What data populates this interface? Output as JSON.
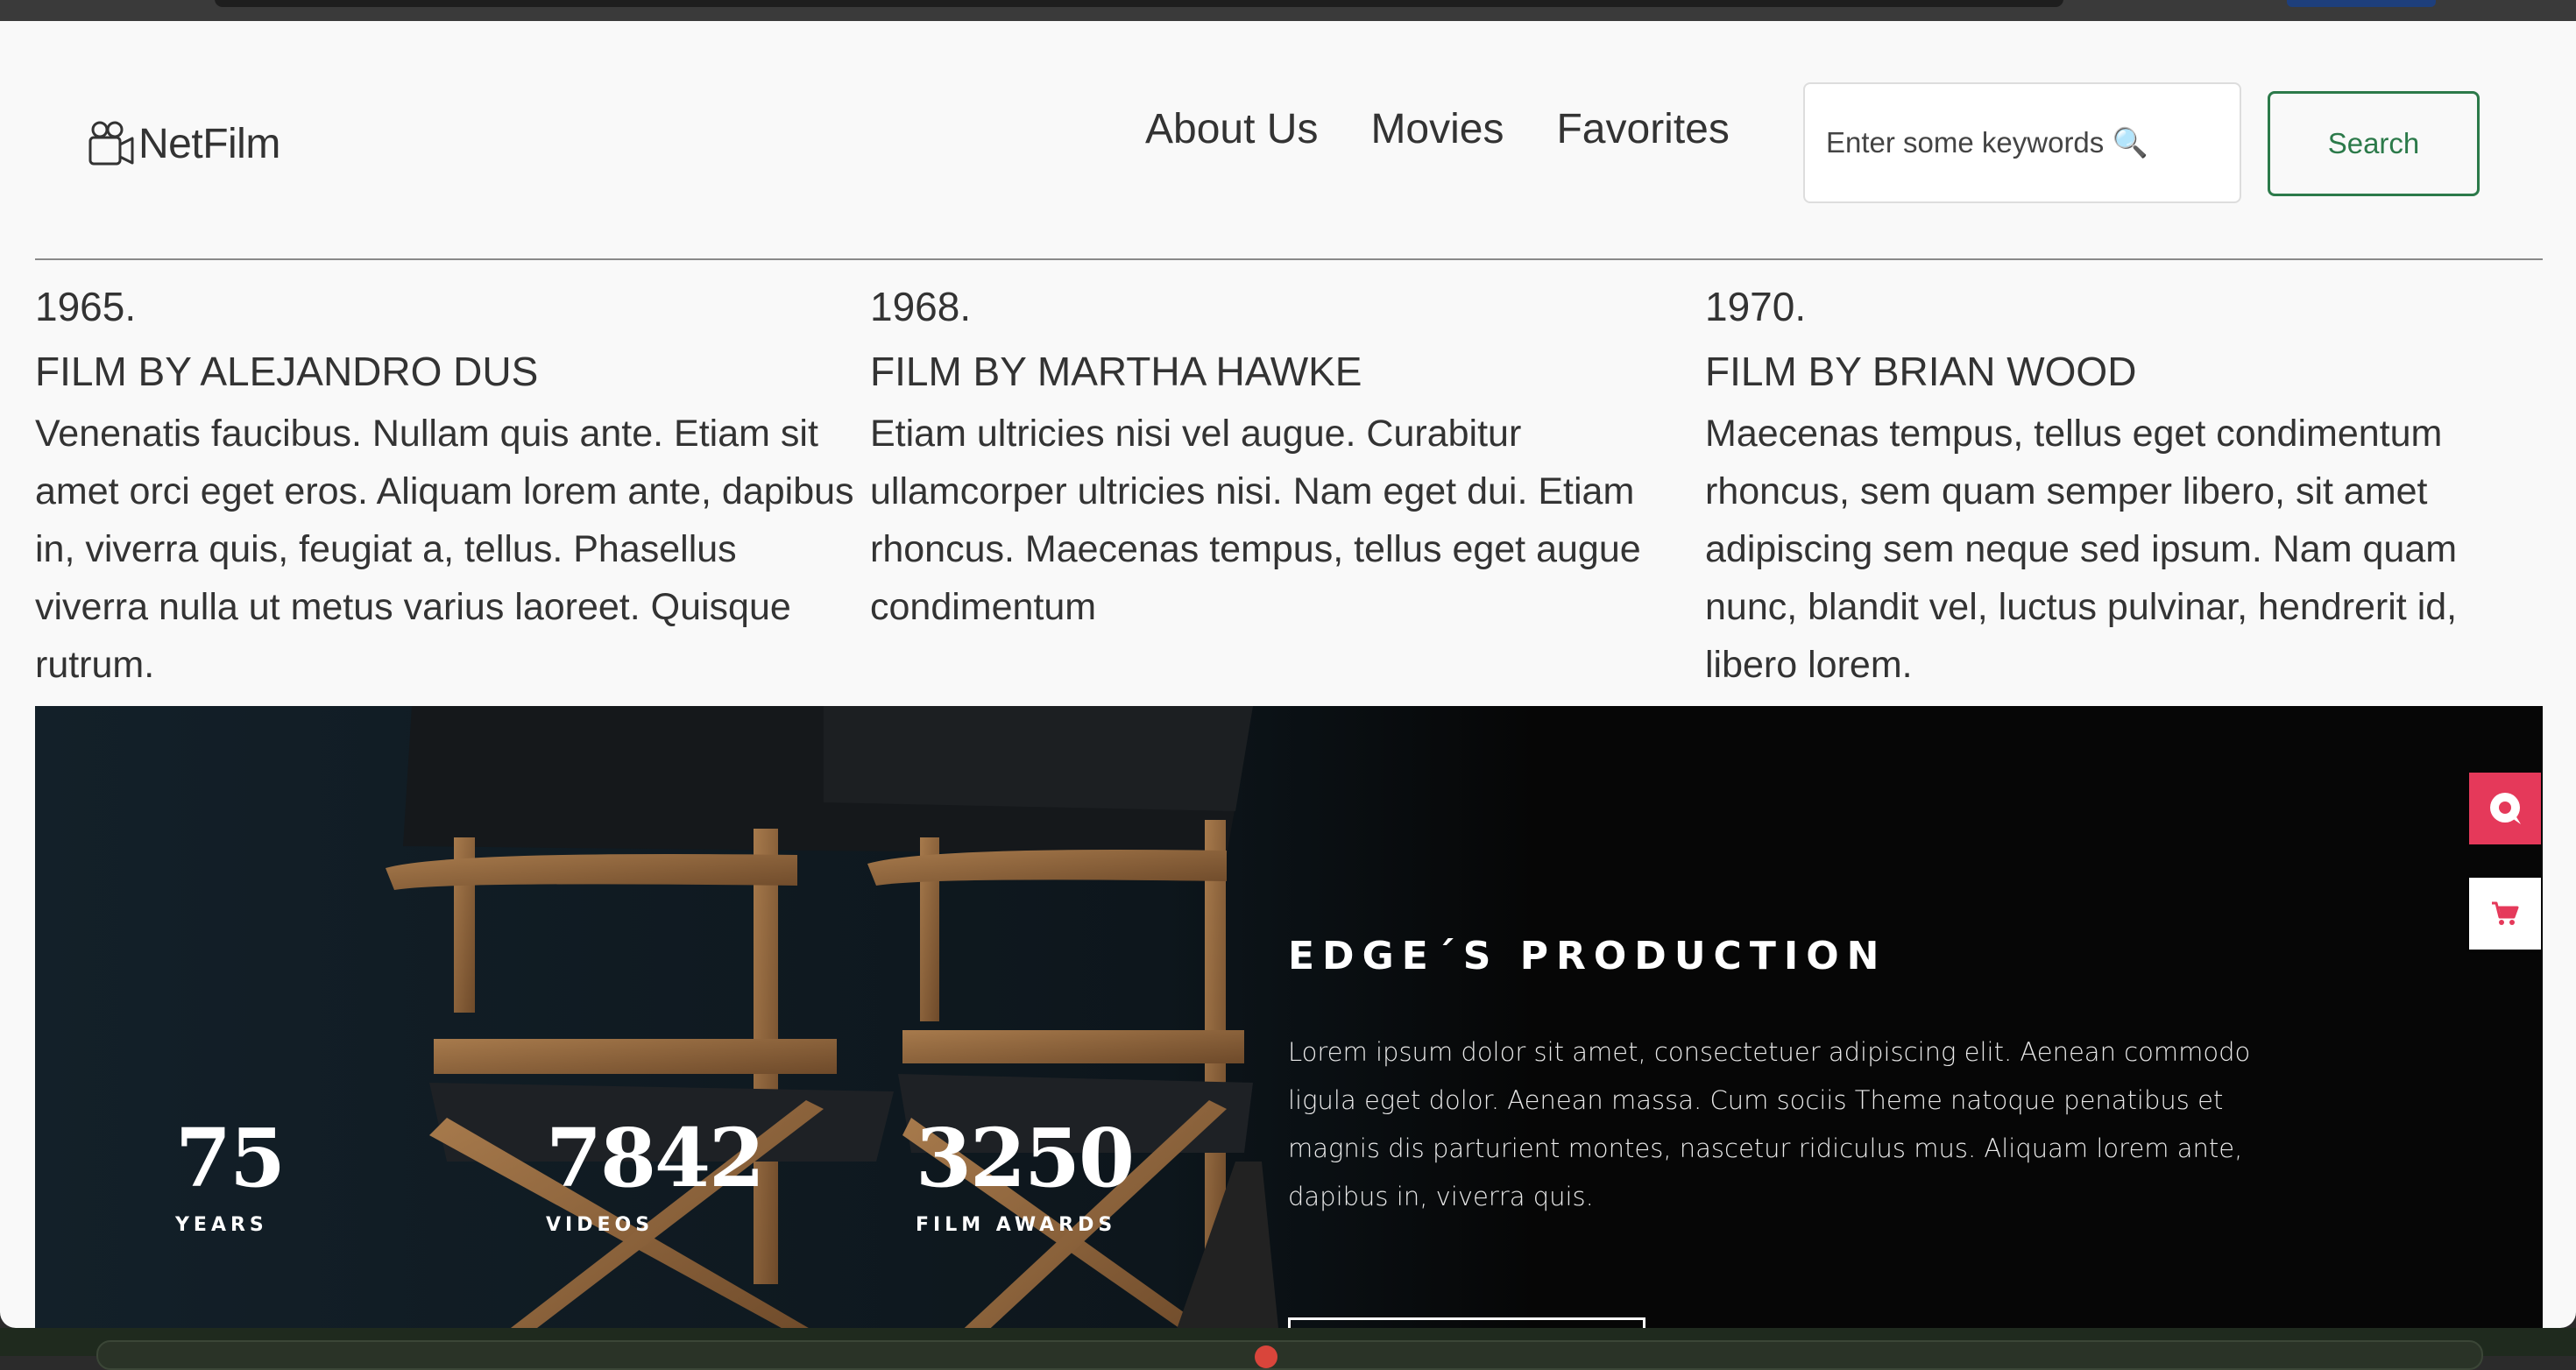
{
  "app": {
    "logo_text": "NetFilm",
    "logo_icon": "movie-camera-icon"
  },
  "nav": {
    "items": [
      {
        "label": "About Us"
      },
      {
        "label": "Movies"
      },
      {
        "label": "Favorites"
      }
    ]
  },
  "search": {
    "placeholder": "Enter some keywords 🔍",
    "value": "",
    "button_label": "Search"
  },
  "films": [
    {
      "year": "1965.",
      "by": "FILM BY ALEJANDRO DUS",
      "description": "Venenatis faucibus. Nullam quis ante. Etiam sit amet orci eget eros. Aliquam lorem ante, dapibus in, viverra quis, feugiat a, tellus. Phasellus viverra nulla ut metus varius laoreet. Quisque rutrum."
    },
    {
      "year": "1968.",
      "by": "FILM BY MARTHA HAWKE",
      "description": "Etiam ultricies nisi vel augue. Curabitur ullamcorper ultricies nisi. Nam eget dui. Etiam rhoncus. Maecenas tempus, tellus eget augue condimentum"
    },
    {
      "year": "1970.",
      "by": "FILM BY BRIAN WOOD",
      "description": "Maecenas tempus, tellus eget condimentum rhoncus, sem quam semper libero, sit amet adipiscing sem neque sed ipsum. Nam quam nunc, blandit vel, luctus pulvinar, hendrerit id, libero lorem."
    }
  ],
  "hero": {
    "stats": [
      {
        "number": "75",
        "label": "YEARS"
      },
      {
        "number": "7842",
        "label": "VIDEOS"
      },
      {
        "number": "3250",
        "label": "FILM AWARDS"
      }
    ],
    "production_title": "EDGE´S PRODUCTION",
    "production_text": "Lorem ipsum dolor sit amet, consectetuer adipiscing elit. Aenean commodo ligula eget dolor. Aenean massa. Cum sociis Theme natoque penatibus et magnis dis parturient montes, nascetur ridiculus mus. Aliquam lorem ante, dapibus in, viverra quis."
  },
  "side_buttons": [
    {
      "icon": "chat-bubble-icon",
      "color": "#e5395a"
    },
    {
      "icon": "shopping-cart-icon",
      "color": "#e5395a"
    }
  ],
  "colors": {
    "accent_green": "#2c7a4a",
    "side_pink": "#e5395a",
    "hero_dark": "#060606"
  }
}
